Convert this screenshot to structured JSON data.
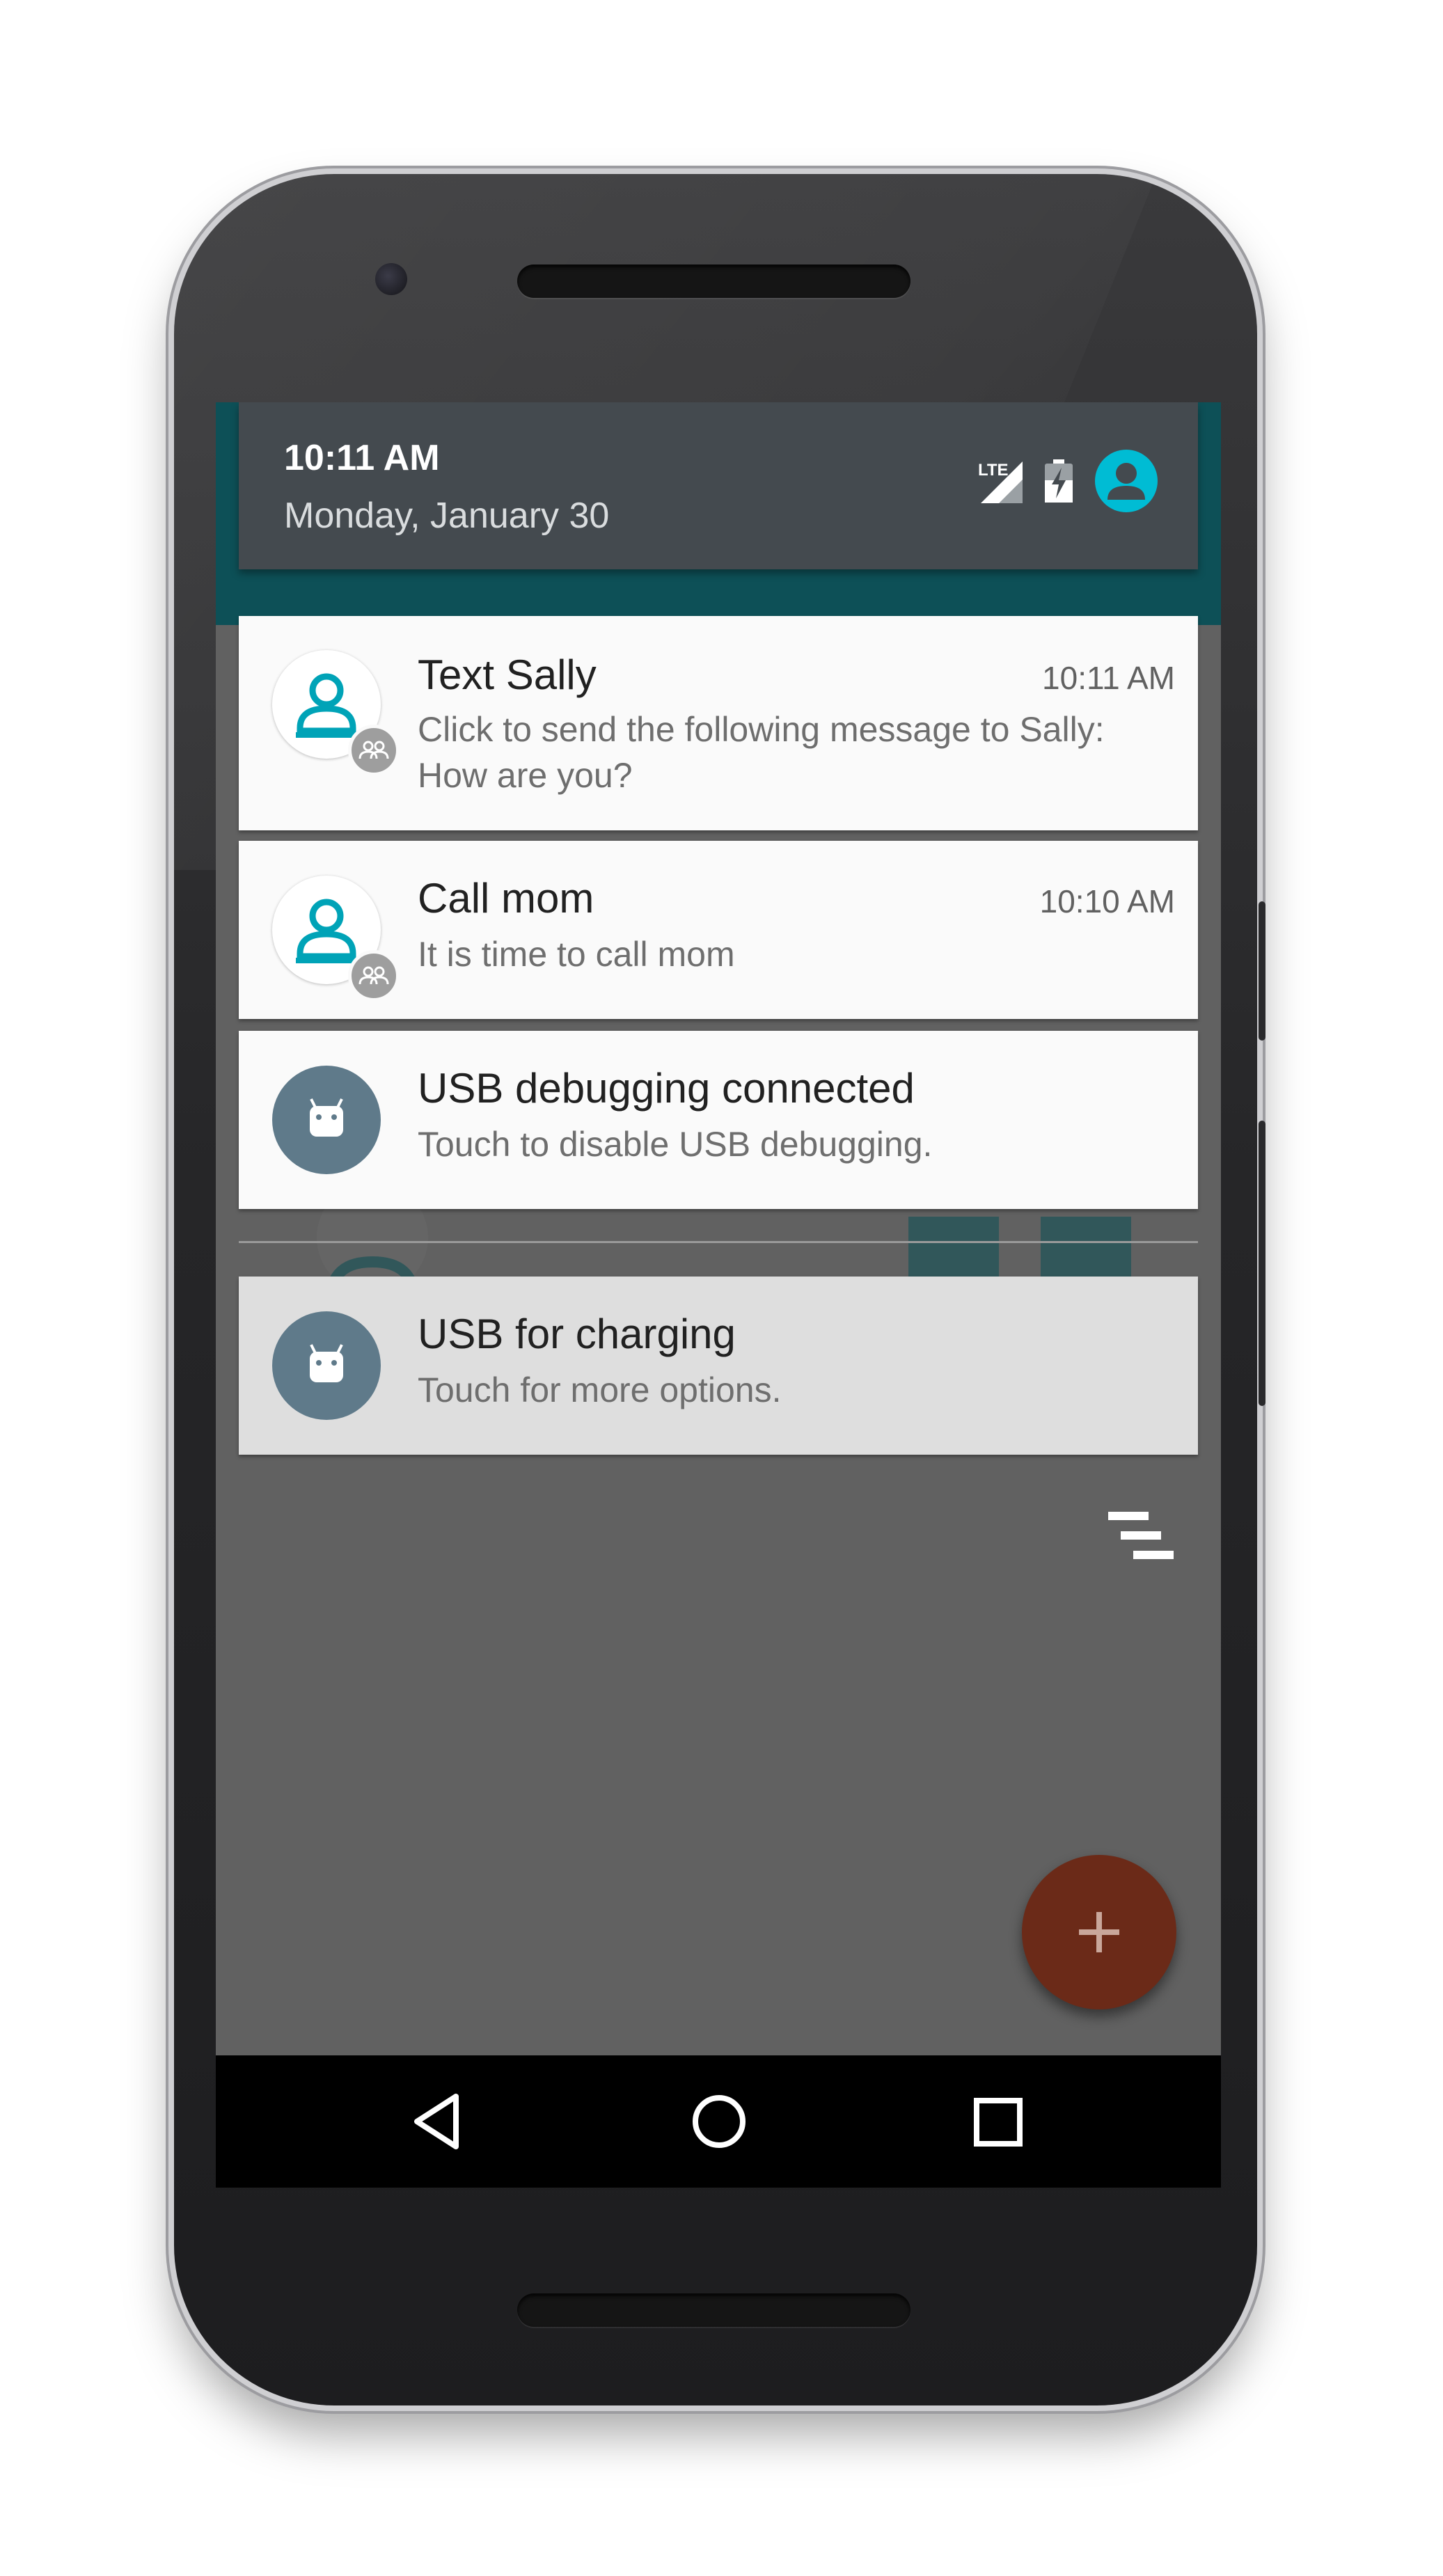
{
  "status_header": {
    "time": "10:11 AM",
    "date": "Monday, January 30",
    "network_label": "LTE",
    "icons": [
      "signal-icon",
      "battery-charging-icon",
      "user-account-icon"
    ]
  },
  "notifications": [
    {
      "title": "Text Sally",
      "time": "10:11 AM",
      "text": "Click to send the following message to Sally: How are you?",
      "icon": "person-icon",
      "badge": "group-icon"
    },
    {
      "title": "Call mom",
      "time": "10:10 AM",
      "text": "It is time to call mom",
      "icon": "person-icon",
      "badge": "group-icon"
    },
    {
      "title": "USB debugging connected",
      "text": "Touch to disable USB debugging.",
      "icon": "android-icon"
    },
    {
      "title": "USB for charging",
      "text": "Touch for more options.",
      "icon": "android-icon"
    }
  ],
  "fab": {
    "icon": "plus-icon"
  },
  "nav": {
    "icons": [
      "back-icon",
      "home-icon",
      "recents-icon"
    ]
  },
  "colors": {
    "accent_teal": "#00a3b7",
    "header_bg": "#444a4f",
    "fab": "#6b2a18",
    "screen_scrim": "#616161"
  }
}
